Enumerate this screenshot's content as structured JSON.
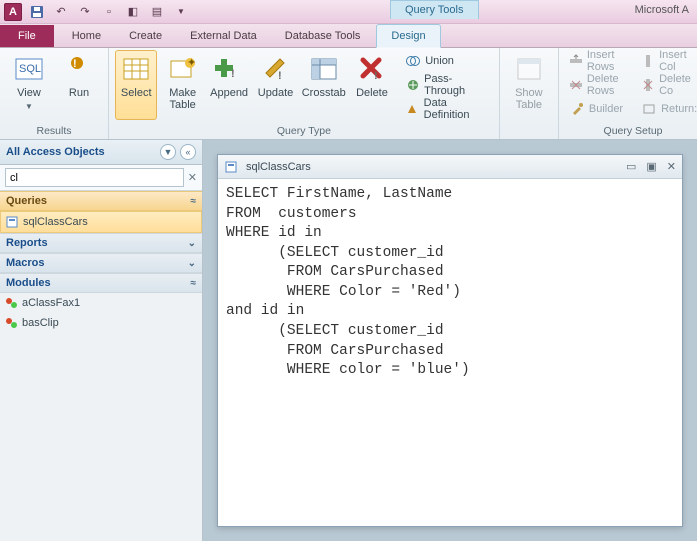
{
  "app": {
    "title_right": "Microsoft A"
  },
  "contextual_tab_group": "Query Tools",
  "tabs": {
    "file": "File",
    "home": "Home",
    "create": "Create",
    "external_data": "External Data",
    "database_tools": "Database Tools",
    "design": "Design"
  },
  "ribbon": {
    "results": {
      "label": "Results",
      "view": "View",
      "run": "Run"
    },
    "query_type": {
      "label": "Query Type",
      "select": "Select",
      "make_table": "Make\nTable",
      "append": "Append",
      "update": "Update",
      "crosstab": "Crosstab",
      "delete": "Delete",
      "union": "Union",
      "pass_through": "Pass-Through",
      "data_definition": "Data Definition"
    },
    "show_table": {
      "label": "",
      "show_table_btn": "Show\nTable"
    },
    "query_setup": {
      "label": "Query Setup",
      "insert_rows": "Insert Rows",
      "delete_rows": "Delete Rows",
      "builder": "Builder",
      "insert_col": "Insert Col",
      "delete_col": "Delete Co",
      "return": "Return:"
    }
  },
  "navpane": {
    "title": "All Access Objects",
    "search_value": "cl",
    "groups": {
      "queries": "Queries",
      "reports": "Reports",
      "macros": "Macros",
      "modules": "Modules"
    },
    "items": {
      "sqlclasscars": "sqlClassCars",
      "aclassfax1": "aClassFax1",
      "basclip": "basClip"
    }
  },
  "sqlwin": {
    "title": "sqlClassCars",
    "sql": "SELECT FirstName, LastName\nFROM  customers\nWHERE id in\n      (SELECT customer_id\n       FROM CarsPurchased\n       WHERE Color = 'Red')\nand id in\n      (SELECT customer_id\n       FROM CarsPurchased\n       WHERE color = 'blue')"
  }
}
